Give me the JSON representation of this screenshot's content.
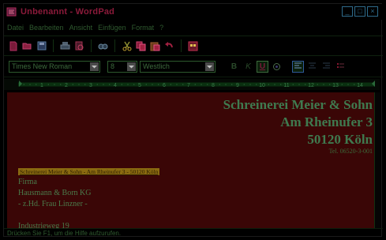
{
  "window": {
    "title": "Unbenannt - WordPad",
    "controls": [
      "_",
      "□",
      "×"
    ]
  },
  "menu": [
    "Datei",
    "Bearbeiten",
    "Ansicht",
    "Einfügen",
    "Format",
    "?"
  ],
  "toolbar": {
    "icons": [
      "new-document-icon",
      "open-icon",
      "save-icon",
      "print-icon",
      "print-preview-icon",
      "find-icon",
      "cut-icon",
      "copy-icon",
      "paste-icon",
      "undo-icon",
      "insert-datetime-icon"
    ]
  },
  "format": {
    "font": "Times New Roman",
    "size": "8",
    "script": "Westlich",
    "buttons": [
      "B",
      "K",
      "U",
      "color",
      "left",
      "center",
      "right",
      "bullets"
    ]
  },
  "ruler": {
    "marks": [
      "1",
      "2",
      "3",
      "4",
      "5",
      "6",
      "7",
      "8",
      "9",
      "10",
      "11",
      "12",
      "13",
      "14"
    ]
  },
  "document": {
    "company_line1": "Schreinerei Meier & Sohn",
    "company_line2": "Am Rheinufer 3",
    "company_line3": "50120 Köln",
    "phone": "Tel. 06520-3-001",
    "sender_line": "Schreinerei Meier & Sohn - Am Rheinufer 3 - 50120 Köln",
    "recipient_1": "Firma",
    "recipient_2": "Hausmann & Born KG",
    "recipient_3": "- z.Hd. Frau Linzner -",
    "recipient_4": "Industrieweg 19"
  },
  "status": {
    "text": "Drücken Sie F1, um die Hilfe aufzurufen."
  },
  "colors": {
    "document_background": "#3a0606",
    "text_green": "#3f7a4f",
    "highlight": "#8a6a10",
    "title_accent": "#8b1a3a"
  }
}
